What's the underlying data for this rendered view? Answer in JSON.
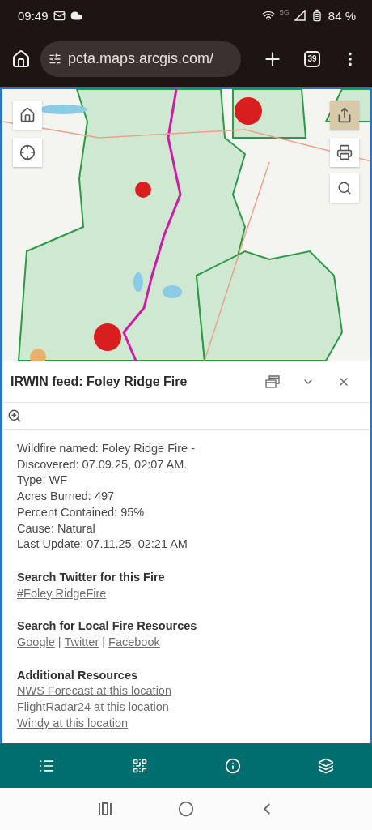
{
  "status_bar": {
    "time": "09:49",
    "network": "5G",
    "battery": "84 %"
  },
  "browser": {
    "url": "pcta.maps.arcgis.com/",
    "tab_count": "39"
  },
  "popup": {
    "title": "IRWIN feed: Foley Ridge Fire",
    "details": [
      "Wildfire named: Foley Ridge Fire -",
      "Discovered: 07.09.25, 02:07 AM.",
      "Type: WF",
      "Acres Burned: 497",
      "Percent Contained: 95%",
      "Cause: Natural",
      "Last Update: 07.11.25, 02:21 AM"
    ],
    "sections": [
      {
        "heading": "Search Twitter for this Fire",
        "kind": "stacked",
        "links": [
          "#Foley RidgeFire"
        ]
      },
      {
        "heading": "Search for Local Fire Resources",
        "kind": "inline",
        "separator": "|",
        "links": [
          "Google",
          "Twitter",
          "Facebook"
        ]
      },
      {
        "heading": "Additional Resources",
        "kind": "stacked",
        "links": [
          "NWS Forecast at this location",
          "FlightRadar24 at this location",
          "Windy at this location"
        ]
      }
    ]
  }
}
